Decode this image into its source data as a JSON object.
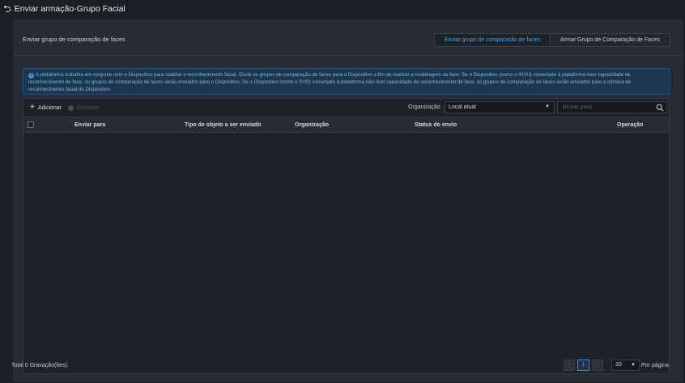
{
  "window": {
    "title": "Enviar armação-Grupo Facial"
  },
  "header": {
    "section_title": "Enviar grupo de comparação de faces",
    "steps": [
      {
        "label": "Enviar grupo de comparação de faces",
        "active": true
      },
      {
        "label": "Armar Grupo de Comparação de Faces",
        "active": false
      }
    ]
  },
  "info": {
    "icon": "info-icon",
    "text": "A plataforma trabalha em conjunto com o Dispositivo para realizar o reconhecimento facial. Envie os grupos de comparação de faces para o Dispositivo a fim de realizar a modelagem da face. Se o Dispositivo (como o iNVU) conectado à plataforma tiver capacidade de reconhecimento de face, os grupos de comparação de faces serão enviados para o Dispositivo. Se o Dispositivo (como o SVS) conectado à plataforma não tiver capacidade de reconhecimento de face, os grupos de comparação de faces serão enviados para a câmera de reconhecimento facial do Dispositivo."
  },
  "toolbar": {
    "add_label": "Adicionar",
    "remove_label": "Remover",
    "org_label": "Organização",
    "org_value": "Local atual",
    "search_placeholder": "Enviar para"
  },
  "table": {
    "columns": [
      "Enviar para",
      "Tipo de objeto a ser enviado",
      "Organização",
      "Status do envio",
      "Operação"
    ],
    "rows": []
  },
  "footer": {
    "total_prefix": "Total",
    "total_count": "0",
    "total_suffix": "Gravação(ões).",
    "current_page": "1",
    "page_size": "20",
    "per_page_label": "Por página"
  }
}
